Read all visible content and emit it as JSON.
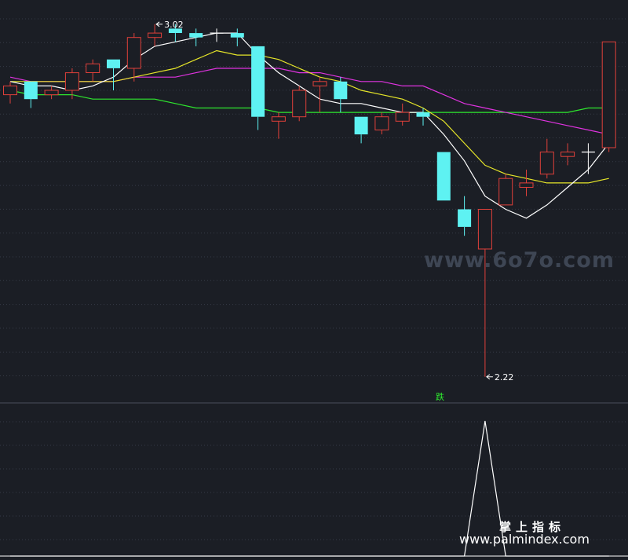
{
  "chart_data": [
    {
      "type": "candlestick",
      "title": "",
      "xlabel": "",
      "ylabel": "",
      "ylim": [
        2.2,
        3.05
      ],
      "grid": true,
      "colors": {
        "up": "#e0403a",
        "down": "#5ef2f2",
        "doji": "#ffffff",
        "ma5": "#ffffff",
        "ma10": "#e6e629",
        "ma20": "#e033e0",
        "ma60": "#2ee82e"
      },
      "candles": [
        {
          "o": 2.86,
          "c": 2.88,
          "h": 2.89,
          "l": 2.84
        },
        {
          "o": 2.89,
          "c": 2.85,
          "h": 2.89,
          "l": 2.83
        },
        {
          "o": 2.86,
          "c": 2.87,
          "h": 2.88,
          "l": 2.85
        },
        {
          "o": 2.87,
          "c": 2.91,
          "h": 2.92,
          "l": 2.85
        },
        {
          "o": 2.91,
          "c": 2.93,
          "h": 2.94,
          "l": 2.89
        },
        {
          "o": 2.94,
          "c": 2.92,
          "h": 2.94,
          "l": 2.87
        },
        {
          "o": 2.92,
          "c": 2.99,
          "h": 3.0,
          "l": 2.89
        },
        {
          "o": 2.99,
          "c": 3.0,
          "h": 3.02,
          "l": 2.97
        },
        {
          "o": 3.01,
          "c": 3.0,
          "h": 3.02,
          "l": 2.98
        },
        {
          "o": 3.0,
          "c": 2.99,
          "h": 3.01,
          "l": 2.97
        },
        {
          "o": 3.0,
          "c": 3.0,
          "h": 3.01,
          "l": 2.98
        },
        {
          "o": 3.0,
          "c": 2.99,
          "h": 3.01,
          "l": 2.97
        },
        {
          "o": 2.97,
          "c": 2.81,
          "h": 2.97,
          "l": 2.78
        },
        {
          "o": 2.8,
          "c": 2.81,
          "h": 2.82,
          "l": 2.76
        },
        {
          "o": 2.81,
          "c": 2.87,
          "h": 2.88,
          "l": 2.8
        },
        {
          "o": 2.88,
          "c": 2.89,
          "h": 2.9,
          "l": 2.82
        },
        {
          "o": 2.89,
          "c": 2.85,
          "h": 2.9,
          "l": 2.82
        },
        {
          "o": 2.81,
          "c": 2.77,
          "h": 2.81,
          "l": 2.75
        },
        {
          "o": 2.78,
          "c": 2.81,
          "h": 2.82,
          "l": 2.77
        },
        {
          "o": 2.8,
          "c": 2.82,
          "h": 2.84,
          "l": 2.79
        },
        {
          "o": 2.82,
          "c": 2.81,
          "h": 2.83,
          "l": 2.79
        },
        {
          "o": 2.73,
          "c": 2.62,
          "h": 2.73,
          "l": 2.62
        },
        {
          "o": 2.6,
          "c": 2.56,
          "h": 2.63,
          "l": 2.54
        },
        {
          "o": 2.51,
          "c": 2.6,
          "h": 2.6,
          "l": 2.22
        },
        {
          "o": 2.61,
          "c": 2.67,
          "h": 2.68,
          "l": 2.61
        },
        {
          "o": 2.65,
          "c": 2.66,
          "h": 2.69,
          "l": 2.63
        },
        {
          "o": 2.68,
          "c": 2.73,
          "h": 2.76,
          "l": 2.67
        },
        {
          "o": 2.72,
          "c": 2.73,
          "h": 2.75,
          "l": 2.7
        },
        {
          "o": 2.73,
          "c": 2.73,
          "h": 2.75,
          "l": 2.68
        },
        {
          "o": 2.74,
          "c": 2.98,
          "h": 2.98,
          "l": 2.73
        }
      ],
      "ma5": [
        2.89,
        2.88,
        2.88,
        2.87,
        2.88,
        2.9,
        2.94,
        2.97,
        2.98,
        2.99,
        3.0,
        3.0,
        2.95,
        2.91,
        2.88,
        2.85,
        2.84,
        2.84,
        2.83,
        2.82,
        2.82,
        2.77,
        2.71,
        2.63,
        2.6,
        2.58,
        2.61,
        2.65,
        2.69,
        2.75
      ],
      "ma10": [
        2.89,
        2.89,
        2.89,
        2.89,
        2.89,
        2.89,
        2.9,
        2.91,
        2.92,
        2.94,
        2.96,
        2.95,
        2.95,
        2.94,
        2.92,
        2.9,
        2.89,
        2.87,
        2.86,
        2.85,
        2.83,
        2.8,
        2.75,
        2.7,
        2.68,
        2.67,
        2.66,
        2.66,
        2.66,
        2.67
      ],
      "ma20": [
        2.9,
        2.89,
        2.89,
        2.89,
        2.89,
        2.89,
        2.9,
        2.9,
        2.9,
        2.91,
        2.92,
        2.92,
        2.92,
        2.92,
        2.91,
        2.91,
        2.9,
        2.89,
        2.89,
        2.88,
        2.88,
        2.86,
        2.84,
        2.83,
        2.82,
        2.81,
        2.8,
        2.79,
        2.78,
        2.77
      ],
      "ma60": [
        2.87,
        2.86,
        2.86,
        2.86,
        2.85,
        2.85,
        2.85,
        2.85,
        2.84,
        2.83,
        2.83,
        2.83,
        2.83,
        2.82,
        2.82,
        2.82,
        2.82,
        2.82,
        2.82,
        2.82,
        2.82,
        2.82,
        2.82,
        2.82,
        2.82,
        2.82,
        2.82,
        2.82,
        2.83,
        2.83
      ],
      "annotations": [
        {
          "label": "3.02",
          "index": 7,
          "value": 3.02
        },
        {
          "label": "2.22",
          "index": 23,
          "value": 2.22
        }
      ],
      "signal": {
        "label": "跌",
        "index": 21
      }
    },
    {
      "type": "line",
      "title": "",
      "ylim": [
        0,
        1
      ],
      "values": [
        0,
        0,
        0,
        0,
        0,
        0,
        0,
        0,
        0,
        0,
        0,
        0,
        0,
        0,
        0,
        0,
        0,
        0,
        0,
        0,
        0,
        0,
        0,
        1,
        0,
        0,
        0,
        0,
        0,
        0
      ],
      "color": "#ffffff"
    }
  ],
  "watermarks": {
    "top": "www.6o7o.com",
    "brand_cn": "掌上指标",
    "brand_url": "www.palmindex.com"
  }
}
